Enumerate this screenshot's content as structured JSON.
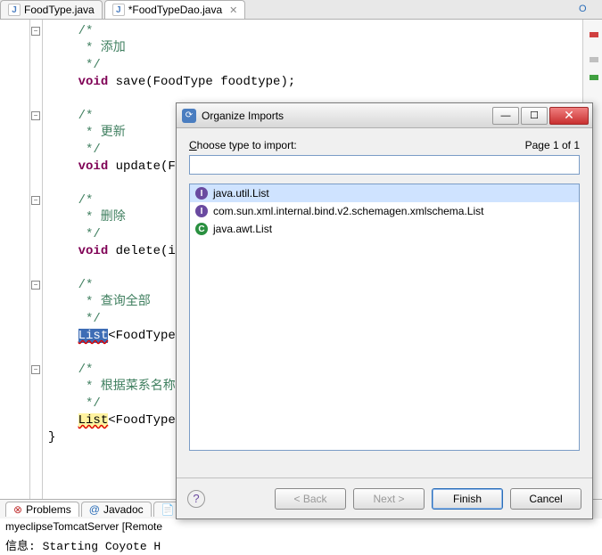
{
  "tabs": [
    {
      "label": "FoodType.java",
      "dirty": false
    },
    {
      "label": "*FoodTypeDao.java",
      "dirty": true
    }
  ],
  "code": {
    "lines": [
      {
        "t": "    /*",
        "cls": "cmt",
        "fold": "-"
      },
      {
        "t": "     * 添加",
        "cls": "cmt"
      },
      {
        "t": "     */",
        "cls": "cmt"
      },
      {
        "t": "    void save(FoodType foodtype);",
        "kw": "void"
      },
      {
        "t": "",
        "cls": ""
      },
      {
        "t": "    /*",
        "cls": "cmt",
        "fold": "-"
      },
      {
        "t": "     * 更新",
        "cls": "cmt"
      },
      {
        "t": "     */",
        "cls": "cmt"
      },
      {
        "t": "    void update(Fo",
        "kw": "void"
      },
      {
        "t": "",
        "cls": ""
      },
      {
        "t": "    /*",
        "cls": "cmt",
        "fold": "-"
      },
      {
        "t": "     * 删除",
        "cls": "cmt"
      },
      {
        "t": "     */",
        "cls": "cmt"
      },
      {
        "t": "    void delete(in",
        "kw": "void"
      },
      {
        "t": "",
        "cls": ""
      },
      {
        "t": "    /*",
        "cls": "cmt",
        "fold": "-"
      },
      {
        "t": "     * 查询全部",
        "cls": "cmt"
      },
      {
        "t": "     */",
        "cls": "cmt"
      },
      {
        "t": "    List<FoodType>",
        "hl": "List",
        "err": true
      },
      {
        "t": "",
        "cls": ""
      },
      {
        "t": "    /*",
        "cls": "cmt",
        "fold": "-"
      },
      {
        "t": "     * 根据菜系名称搜索",
        "cls": "cmt"
      },
      {
        "t": "     */",
        "cls": "cmt"
      },
      {
        "t": "    List<FoodType>",
        "hl2": "List",
        "err": true
      },
      {
        "t": "}",
        "cls": ""
      }
    ]
  },
  "bottom_tabs": [
    {
      "label": "Problems",
      "icon": "!"
    },
    {
      "label": "Javadoc",
      "icon": "@"
    },
    {
      "label": "D",
      "icon": ""
    }
  ],
  "console1": "myeclipseTomcatServer [Remote ",
  "console2": "信息: Starting Coyote H",
  "dialog": {
    "title": "Organize Imports",
    "prompt": "Choose type to import:",
    "page_label": "Page 1 of 1",
    "input_value": "",
    "options": [
      {
        "kind": "interface",
        "text": "java.util.List",
        "selected": true
      },
      {
        "kind": "interface",
        "text": "com.sun.xml.internal.bind.v2.schemagen.xmlschema.List",
        "selected": false
      },
      {
        "kind": "class",
        "text": "java.awt.List",
        "selected": false
      }
    ],
    "buttons": {
      "back": "< Back",
      "next": "Next >",
      "finish": "Finish",
      "cancel": "Cancel"
    }
  },
  "outline_hint": "O"
}
